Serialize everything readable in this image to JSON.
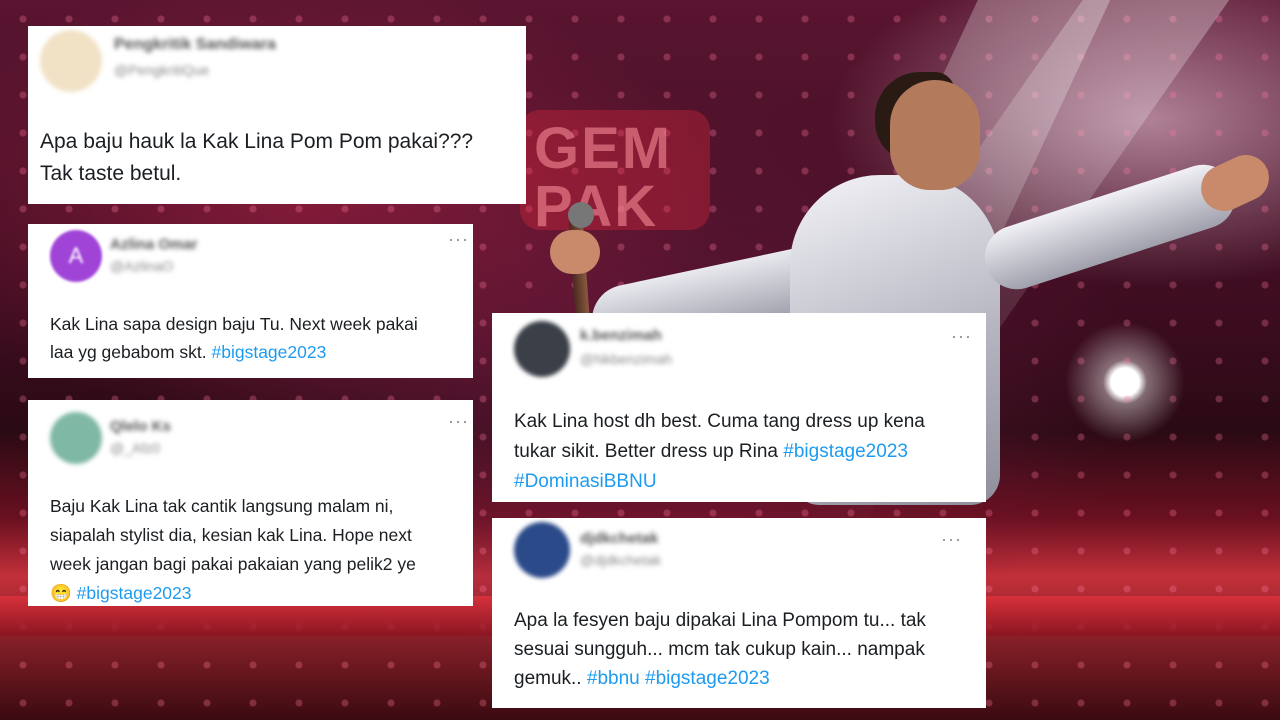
{
  "watermark": "GEM PAK",
  "colors": {
    "hashtag": "#1d9bf0",
    "card_bg": "#ffffff",
    "stage_red": "#c2303a"
  },
  "tweets": [
    {
      "name": "Pengkritik Sandiwara",
      "handle": "@PengkritiQue",
      "avatar_color": "#f1e2c6",
      "lines": [
        "Apa baju hauk la Kak Lina Pom Pom pakai???",
        "Tak taste betul."
      ]
    },
    {
      "name": "Azlina Omar",
      "handle": "@AzlinaO",
      "avatar_color": "#a044d8",
      "avatar_letter": "A",
      "more_icon": "more-dots-icon",
      "lines": [
        "Kak Lina sapa design baju Tu. Next week pakai",
        "laa yg gebabom skt."
      ],
      "hashtags": [
        "#bigstage2023"
      ]
    },
    {
      "name": "Qlelo Ks",
      "handle": "@_Afz0",
      "avatar_color": "#7fb8a4",
      "more_icon": "more-dots-icon",
      "lines": [
        "Baju Kak Lina tak cantik langsung malam ni,",
        "siapalah stylist dia,  kesian kak Lina. Hope next",
        "week jangan bagi pakai pakaian yang pelik2 ye"
      ],
      "emoji": "😁",
      "hashtags": [
        "#bigstage2023"
      ]
    },
    {
      "name": "k.benzimah",
      "handle": "@Nkbenzimah",
      "avatar_color": "#3a3f48",
      "more_icon": "more-dots-icon",
      "lines": [
        "Kak Lina host dh best. Cuma tang dress up kena",
        "tukar sikit. Better dress up Rina"
      ],
      "hashtags": [
        "#bigstage2023",
        "#DominasiBBNU"
      ]
    },
    {
      "name": "djdkchetak",
      "handle": "@djdkchetak",
      "avatar_color": "#2b4a8a",
      "more_icon": "more-dots-icon",
      "lines": [
        "Apa la fesyen baju dipakai Lina Pompom tu... tak",
        "sesuai sungguh... mcm tak cukup kain... nampak",
        "gemuk.."
      ],
      "hashtags": [
        "#bbnu",
        "#bigstage2023"
      ]
    }
  ]
}
